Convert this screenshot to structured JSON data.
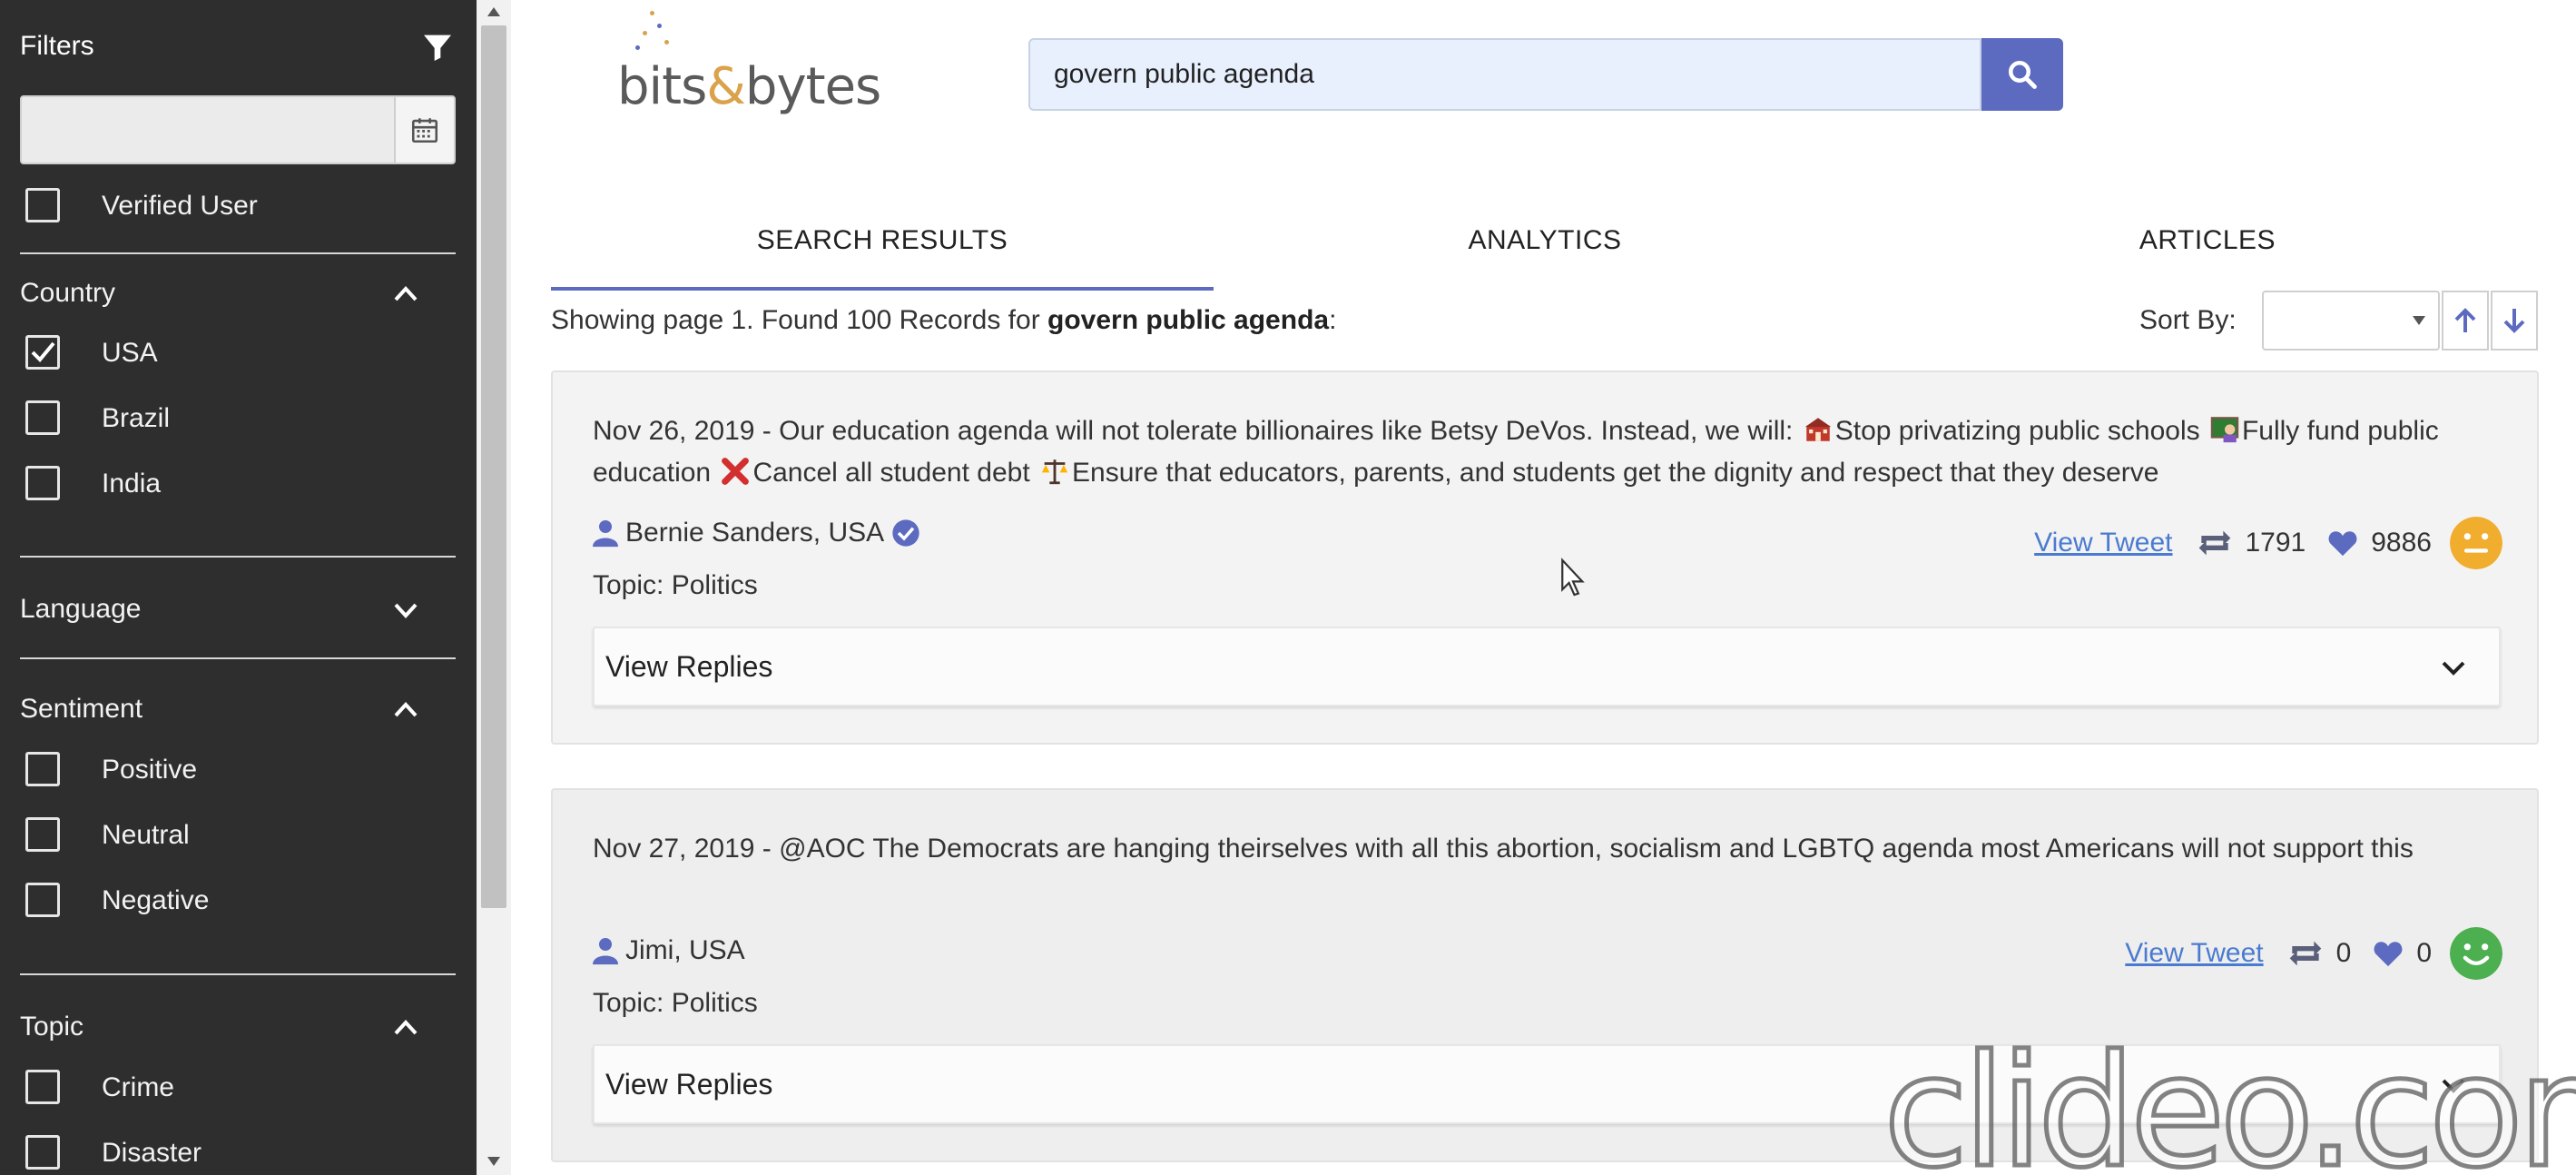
{
  "sidebar": {
    "title": "Filters",
    "date_placeholder": "",
    "verified": {
      "label": "Verified User",
      "checked": false
    },
    "country": {
      "label": "Country",
      "expanded": true,
      "options": [
        {
          "label": "USA",
          "checked": true
        },
        {
          "label": "Brazil",
          "checked": false
        },
        {
          "label": "India",
          "checked": false
        }
      ]
    },
    "language": {
      "label": "Language",
      "expanded": false
    },
    "sentiment": {
      "label": "Sentiment",
      "expanded": true,
      "options": [
        {
          "label": "Positive",
          "checked": false
        },
        {
          "label": "Neutral",
          "checked": false
        },
        {
          "label": "Negative",
          "checked": false
        }
      ]
    },
    "topic": {
      "label": "Topic",
      "expanded": true,
      "options": [
        {
          "label": "Crime",
          "checked": false
        },
        {
          "label": "Disaster",
          "checked": false
        }
      ]
    }
  },
  "header": {
    "logo_left": "bits",
    "logo_amp": "&",
    "logo_right": "bytes",
    "search_value": "govern public agenda"
  },
  "tabs": [
    {
      "label": "SEARCH RESULTS",
      "active": true
    },
    {
      "label": "ANALYTICS",
      "active": false
    },
    {
      "label": "ARTICLES",
      "active": false
    }
  ],
  "results": {
    "prefix": "Showing page 1. Found 100 Records for ",
    "query": "govern public agenda",
    "suffix": ":",
    "sort_label": "Sort By:",
    "sort_value": ""
  },
  "tweets": [
    {
      "date": "Nov 26, 2019",
      "text_1": " - Our education agenda will not tolerate billionaires like Betsy DeVos. Instead, we will: ",
      "text_2": "Stop privatizing public schools ",
      "text_3": "Fully fund public education ",
      "text_4": "Cancel all student debt ",
      "text_5": "Ensure that educators, parents, and students get the dignity and respect that they deserve",
      "author": "Bernie Sanders, USA",
      "verified": true,
      "topic": "Topic: Politics",
      "view_label": "View Tweet",
      "retweets": "1791",
      "likes": "9886",
      "sentiment": "neutral",
      "sentiment_color": "#f0ad2e",
      "replies_label": "View Replies"
    },
    {
      "date": "Nov 27, 2019",
      "text_1": " - @AOC The Democrats are hanging theirselves with all this abortion, socialism and LGBTQ agenda most Americans will not support this",
      "author": "Jimi, USA",
      "verified": false,
      "topic": "Topic: Politics",
      "view_label": "View Tweet",
      "retweets": "0",
      "likes": "0",
      "sentiment": "positive",
      "sentiment_color": "#4caf50",
      "replies_label": "View Replies"
    }
  ],
  "colors": {
    "sidebar": "#2e2e2e",
    "accent": "#5c6bc0",
    "link": "#4a7bd0"
  },
  "watermark": "clideo.com"
}
